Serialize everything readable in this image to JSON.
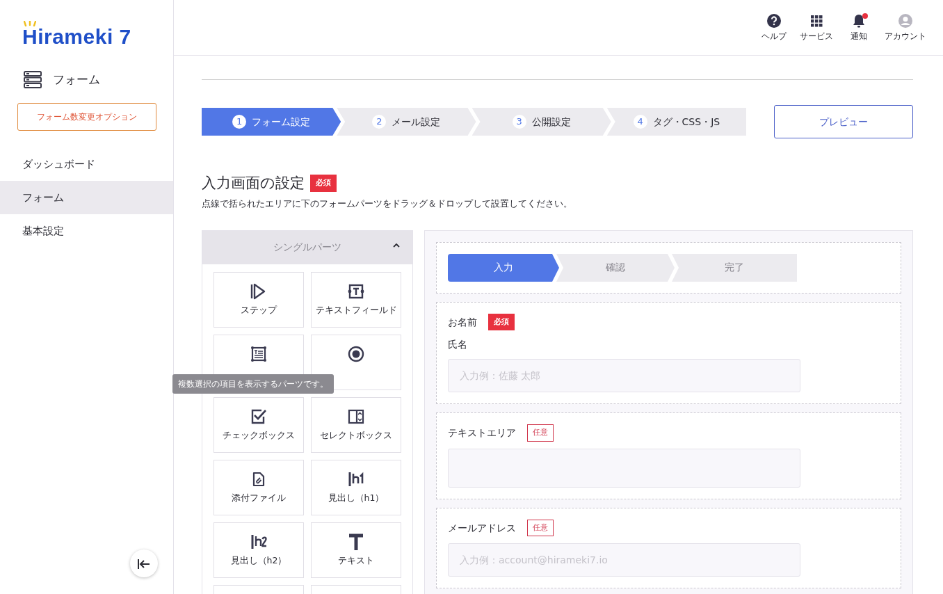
{
  "logo": {
    "text": "Hirameki 7"
  },
  "sidebar": {
    "section_title": "フォーム",
    "option_button": "フォーム数変更オプション",
    "items": [
      {
        "label": "ダッシュボード",
        "selected": false
      },
      {
        "label": "フォーム",
        "selected": true
      },
      {
        "label": "基本設定",
        "selected": false
      }
    ]
  },
  "header": {
    "actions": [
      {
        "kind": "help",
        "label": "ヘルプ"
      },
      {
        "kind": "services",
        "label": "サービス"
      },
      {
        "kind": "notifications",
        "label": "通知",
        "unread": true
      },
      {
        "kind": "account",
        "label": "アカウント"
      }
    ]
  },
  "wizard": {
    "steps": [
      {
        "number": "1",
        "label": "フォーム設定",
        "selected": true
      },
      {
        "number": "2",
        "label": "メール設定",
        "selected": false
      },
      {
        "number": "3",
        "label": "公開設定",
        "selected": false
      },
      {
        "number": "4",
        "label": "タグ・CSS・JS",
        "selected": false
      }
    ],
    "preview_button": "プレビュー"
  },
  "section": {
    "title": "入力画面の設定",
    "badge": "必須",
    "description": "点線で括られたエリアに下のフォームパーツをドラッグ＆ドロップして設置してください。"
  },
  "parts_panel": {
    "title": "シングルパーツ",
    "expanded": true,
    "tooltip": "複数選択の項目を表示するパーツです。",
    "parts": [
      {
        "kind": "step",
        "label": "ステップ"
      },
      {
        "kind": "textfield",
        "label": "テキストフィールド"
      },
      {
        "kind": "textarea"
      },
      {
        "kind": "radio"
      },
      {
        "kind": "checkbox",
        "label": "チェックボックス"
      },
      {
        "kind": "select",
        "label": "セレクトボックス"
      },
      {
        "kind": "file",
        "label": "添付ファイル"
      },
      {
        "kind": "h1",
        "label": "見出し（h1）"
      },
      {
        "kind": "h2",
        "label": "見出し（h2）"
      },
      {
        "kind": "text",
        "label": "テキスト"
      },
      {
        "kind": "cut"
      },
      {
        "kind": "cut"
      }
    ]
  },
  "canvas": {
    "steps": [
      {
        "label": "入力",
        "selected": true
      },
      {
        "label": "確認",
        "selected": false
      },
      {
        "label": "完了",
        "selected": false
      }
    ],
    "fields": [
      {
        "kind": "input",
        "label": "お名前",
        "required": true,
        "badge": "必須",
        "sublabel": "氏名",
        "placeholder": "入力例：佐藤 太郎"
      },
      {
        "kind": "textarea",
        "label": "テキストエリア",
        "required": false,
        "badge": "任意"
      },
      {
        "kind": "input",
        "label": "メールアドレス",
        "required": false,
        "badge": "任意",
        "placeholder": "入力例：account@hirameki7.io"
      }
    ]
  }
}
